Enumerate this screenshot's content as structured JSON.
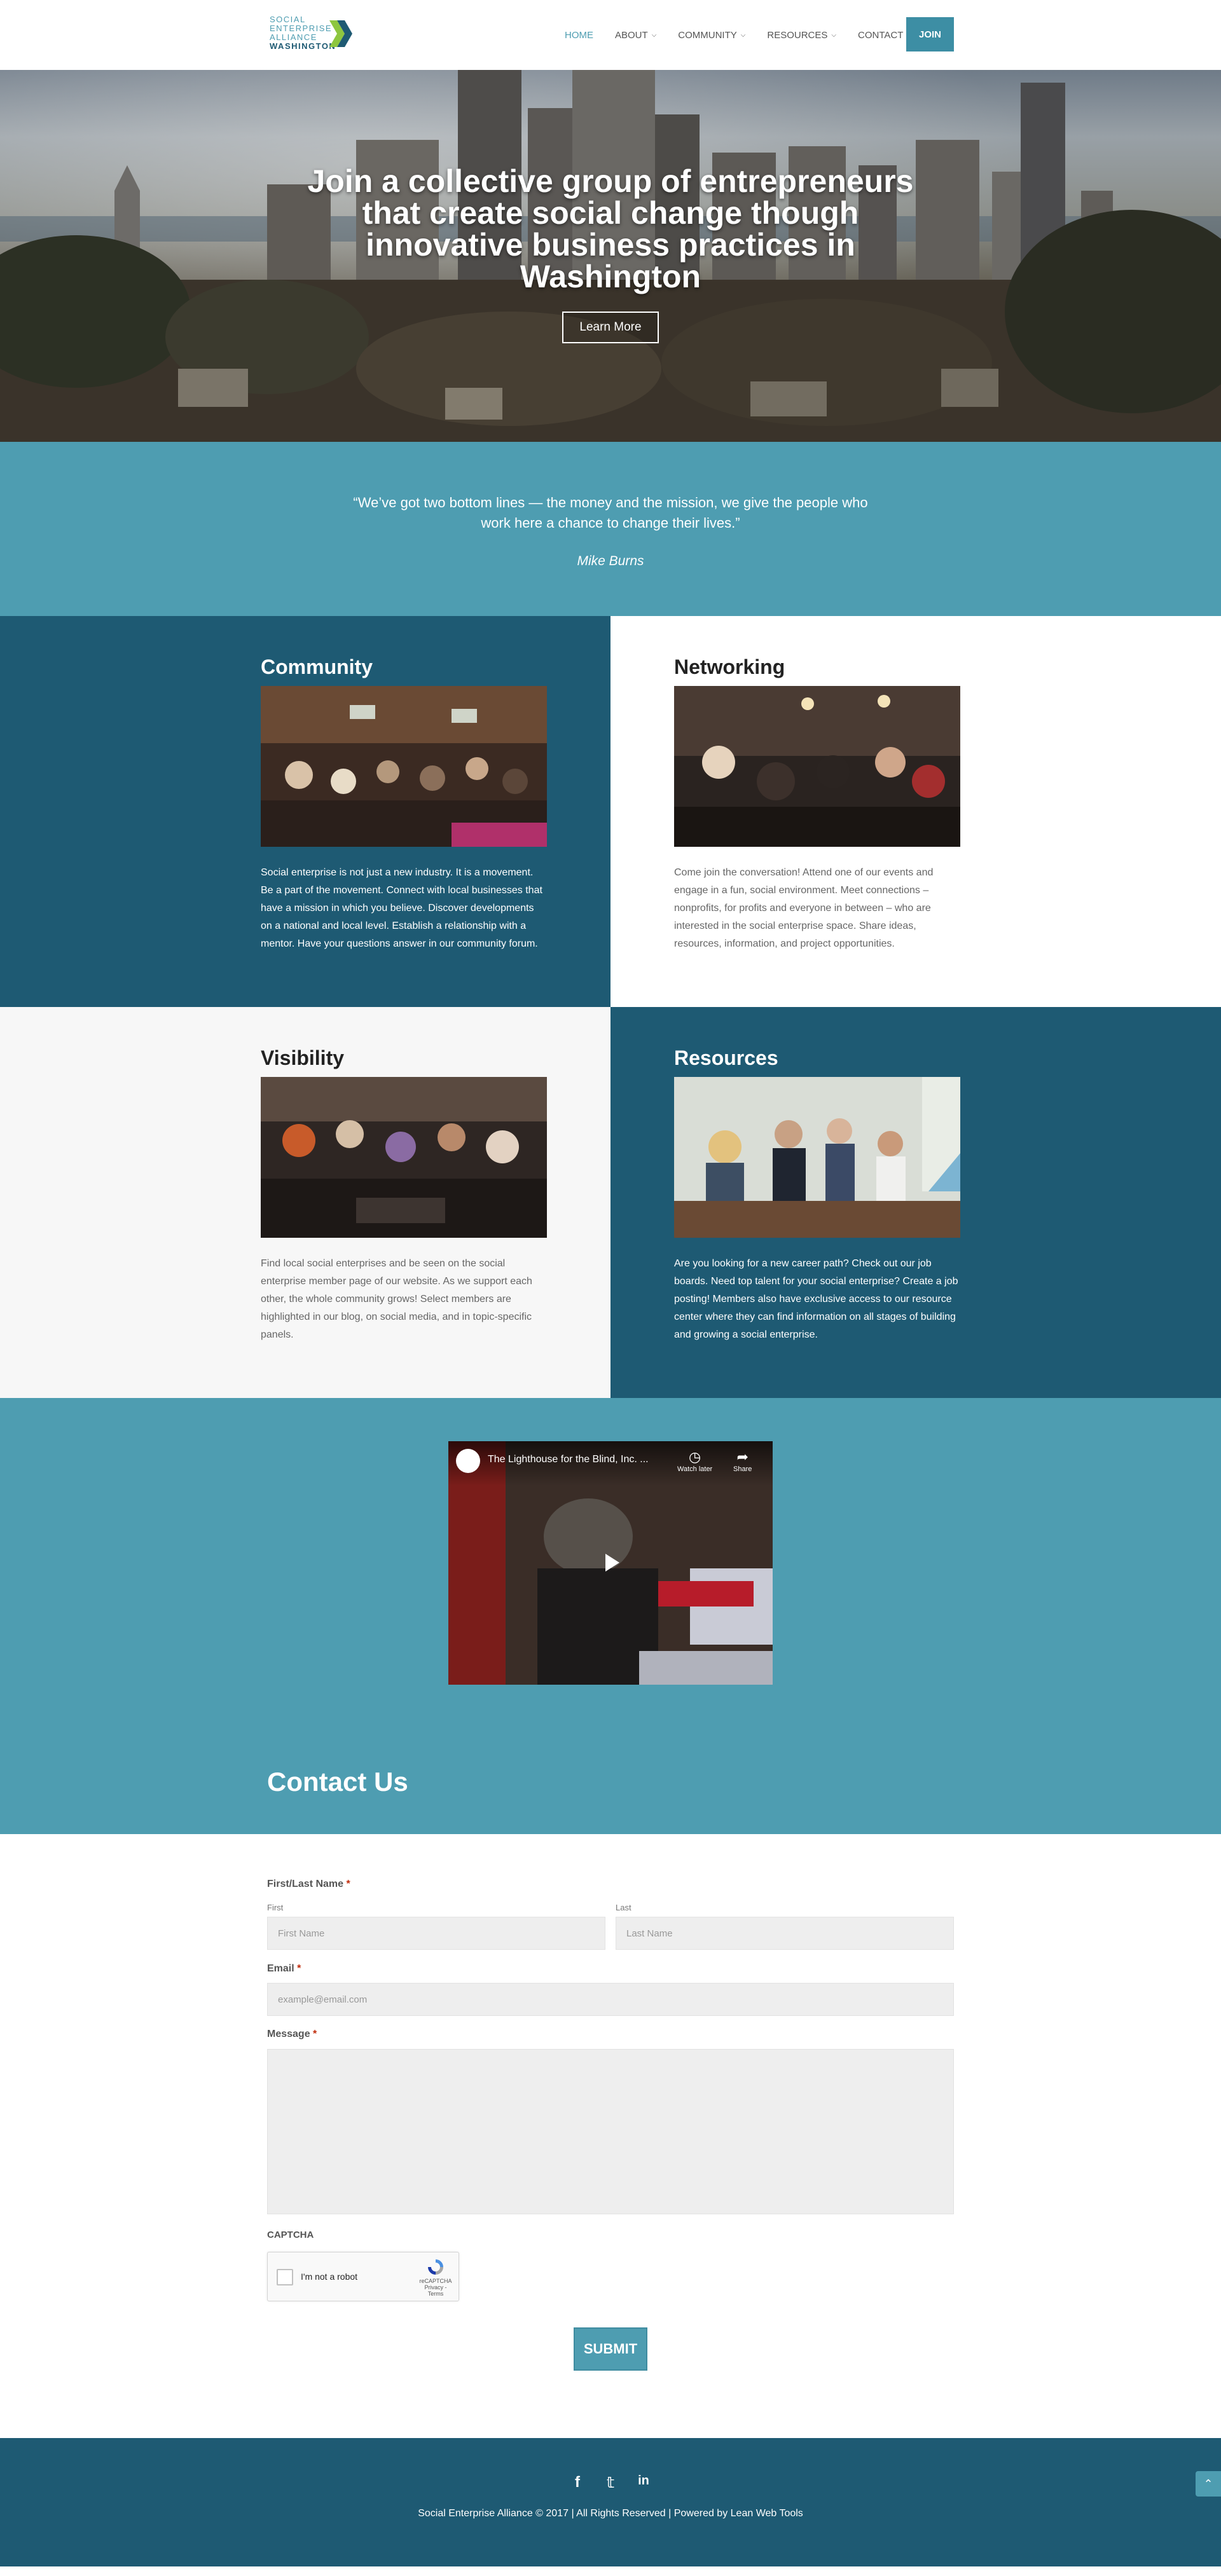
{
  "header": {
    "logo": {
      "line1": "SOCIAL",
      "line2": "ENTERPRISE",
      "line3": "ALLIANCE",
      "line4": "WASHINGTON"
    },
    "nav": [
      {
        "label": "HOME",
        "active": true,
        "dropdown": false
      },
      {
        "label": "ABOUT",
        "active": false,
        "dropdown": true
      },
      {
        "label": "COMMUNITY",
        "active": false,
        "dropdown": true
      },
      {
        "label": "RESOURCES",
        "active": false,
        "dropdown": true
      },
      {
        "label": "CONTACT",
        "active": false,
        "dropdown": false
      }
    ],
    "join_label": "JOIN"
  },
  "hero": {
    "title": "Join a collective group of entrepreneurs that create social change though innovative business practices in Washington",
    "button_label": "Learn More"
  },
  "quote": {
    "text": "“We’ve got two bottom lines — the money and the mission, we give the people who work here a chance to change their lives.”",
    "author": "Mike Burns"
  },
  "features": {
    "community": {
      "title": "Community",
      "text": "Social enterprise is not just a new industry. It is a movement. Be a part of the movement. Connect with local businesses that have a mission in which you believe. Discover developments on a national and local level. Establish a relationship with a mentor. Have your questions answer in our community forum."
    },
    "networking": {
      "title": "Networking",
      "text": "Come join the conversation! Attend one of our events and engage in a fun, social environment. Meet connections – nonprofits, for profits and everyone in between – who are interested in the social enterprise space. Share ideas, resources, information, and project opportunities."
    },
    "visibility": {
      "title": "Visibility",
      "text": "Find local social enterprises and be seen on the social enterprise member page of our website. As we support each other, the whole community grows! Select members are highlighted in our blog, on social media, and in topic-specific panels."
    },
    "resources": {
      "title": "Resources",
      "text": "Are you looking for a new career path? Check out our job boards. Need top talent for your social enterprise? Create a job posting! Members also have exclusive access to our resource center where they can find information on all stages of building and growing a social enterprise."
    }
  },
  "video": {
    "title": "The Lighthouse for the Blind, Inc. ...",
    "watch_later": "Watch later",
    "share": "Share"
  },
  "contact": {
    "title": "Contact Us",
    "name_label": "First/Last Name",
    "first_sub": "First",
    "last_sub": "Last",
    "first_placeholder": "First Name",
    "last_placeholder": "Last Name",
    "email_label": "Email",
    "email_placeholder": "example@email.com",
    "message_label": "Message",
    "required_mark": "*",
    "captcha_label": "CAPTCHA",
    "captcha_text": "I'm not a robot",
    "captcha_brand": "reCAPTCHA",
    "captcha_links": "Privacy - Terms",
    "submit_label": "SUBMIT"
  },
  "footer": {
    "social_icons": [
      "facebook-icon",
      "twitter-icon",
      "linkedin-icon"
    ],
    "copyright": "Social Enterprise Alliance © 2017 | All Rights Reserved | Powered by Lean Web Tools"
  },
  "colors": {
    "teal": "#4e9db1",
    "dark_teal": "#1e5a73",
    "required": "#c02b0a"
  }
}
